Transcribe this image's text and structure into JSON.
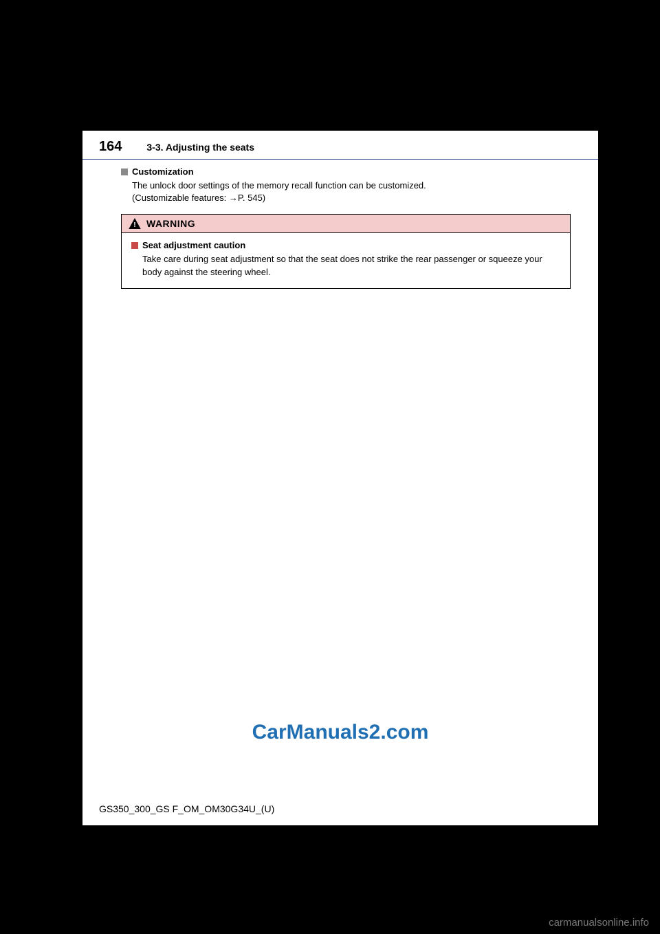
{
  "header": {
    "page_number": "164",
    "section": "3-3. Adjusting the seats"
  },
  "customization": {
    "heading": "Customization",
    "line1": "The unlock door settings of the memory recall function can be customized.",
    "line2": "(Customizable features: →P. 545)"
  },
  "warning": {
    "label": "WARNING",
    "sub_heading": "Seat adjustment caution",
    "text": "Take care during seat adjustment so that the seat does not strike the rear passenger or squeeze your body against the steering wheel."
  },
  "watermark_main": "CarManuals2.com",
  "footer_code": "GS350_300_GS F_OM_OM30G34U_(U)",
  "watermark_bottom": "carmanualsonline.info"
}
